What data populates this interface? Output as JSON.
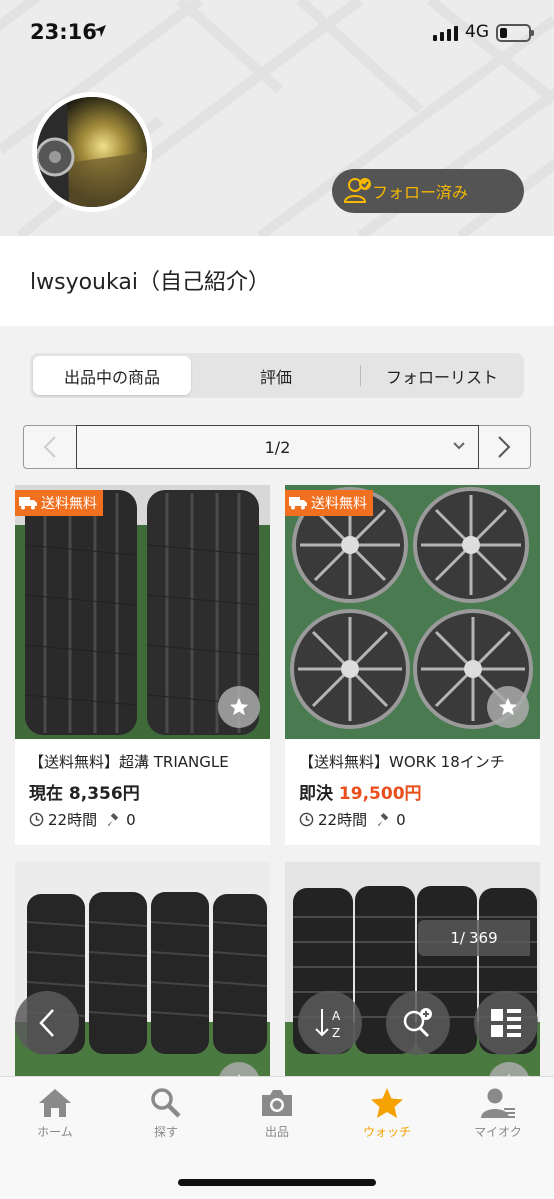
{
  "status_bar": {
    "time": "23:16",
    "network": "4G"
  },
  "profile": {
    "follow_button": "フォロー済み",
    "name": "lwsyoukai（自己紹介）"
  },
  "tabs": [
    {
      "label": "出品中の商品",
      "active": true
    },
    {
      "label": "評価",
      "active": false
    },
    {
      "label": "フォローリスト",
      "active": false
    }
  ],
  "pager": {
    "value": "1/2"
  },
  "listings": [
    {
      "badge": "送料無料",
      "title": "【送料無料】超溝 TRIANGLE",
      "price_prefix": "現在",
      "price": "8,356円",
      "time_left": "22時間",
      "bids": "0"
    },
    {
      "badge": "送料無料",
      "title": "【送料無料】WORK 18インチ",
      "price_prefix": "即決",
      "price": "19,500円",
      "time_left": "22時間",
      "bids": "0"
    }
  ],
  "image_counter": {
    "current": "1/",
    "total": "369"
  },
  "bottom_nav": [
    {
      "label": "ホーム",
      "icon": "home-icon",
      "active": false
    },
    {
      "label": "探す",
      "icon": "search-icon",
      "active": false
    },
    {
      "label": "出品",
      "icon": "camera-icon",
      "active": false
    },
    {
      "label": "ウォッチ",
      "icon": "star-icon",
      "active": true
    },
    {
      "label": "マイオク",
      "icon": "user-icon",
      "active": false
    }
  ],
  "colors": {
    "accent": "#f5a200",
    "price_red": "#e94e1b",
    "badge_orange": "#f07020",
    "follow_bg": "#545454"
  }
}
